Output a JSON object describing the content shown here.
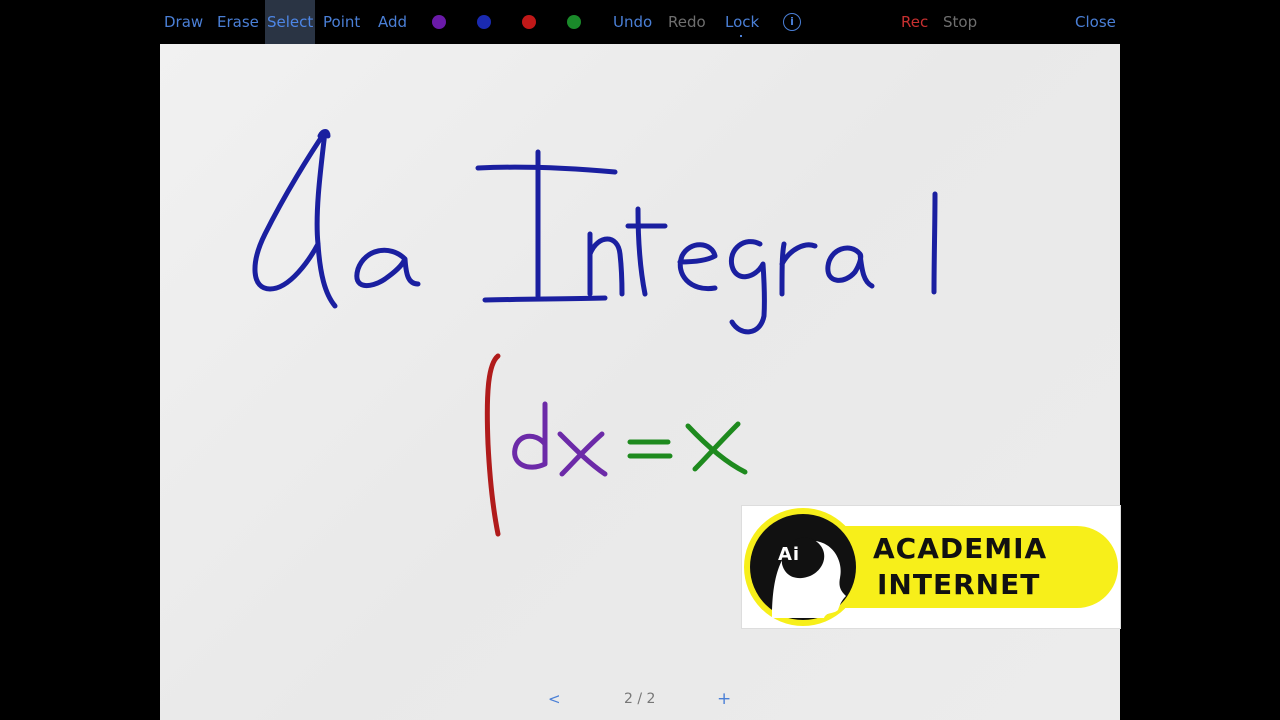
{
  "toolbar": {
    "draw": "Draw",
    "erase": "Erase",
    "select": "Select",
    "point": "Point",
    "add": "Add",
    "colors": [
      "#6a1aa8",
      "#1a2ab0",
      "#c01818",
      "#1a8a2a"
    ],
    "undo": "Undo",
    "redo": "Redo",
    "lock": "Lock",
    "info": "i",
    "rec": "Rec",
    "stop": "Stop",
    "close": "Close"
  },
  "canvas": {
    "title_text": "La Integral",
    "formula": "∫dx = x",
    "ink_colors": {
      "title": "#1a1fa0",
      "integral": "#b01b1b",
      "dx": "#6c2aa8",
      "equals_x": "#1e8a1e"
    }
  },
  "logo": {
    "badge": "Ai",
    "line1": "ACADEMIA",
    "line2": "INTERNET",
    "color": "#f7ef1a"
  },
  "footer": {
    "prev": "<",
    "page": "2 / 2",
    "add": "+"
  }
}
